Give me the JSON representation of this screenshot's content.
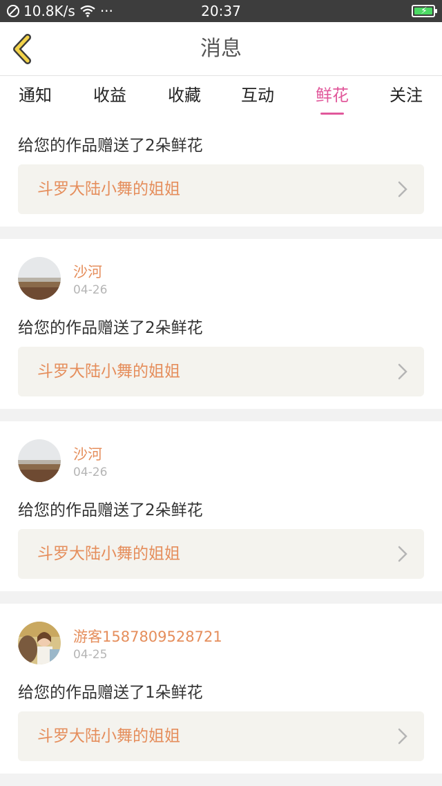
{
  "status_bar": {
    "speed": "10.8K/s",
    "dots": "···",
    "time": "20:37"
  },
  "header": {
    "title": "消息"
  },
  "tabs": [
    {
      "label": "通知",
      "active": false
    },
    {
      "label": "收益",
      "active": false
    },
    {
      "label": "收藏",
      "active": false
    },
    {
      "label": "互动",
      "active": false
    },
    {
      "label": "鲜花",
      "active": true
    },
    {
      "label": "关注",
      "active": false
    }
  ],
  "messages": [
    {
      "message": "给您的作品赠送了2朵鲜花",
      "work": "斗罗大陆小舞的姐姐"
    },
    {
      "user": "沙河",
      "date": "04-26",
      "message": "给您的作品赠送了2朵鲜花",
      "work": "斗罗大陆小舞的姐姐"
    },
    {
      "user": "沙河",
      "date": "04-26",
      "message": "给您的作品赠送了2朵鲜花",
      "work": "斗罗大陆小舞的姐姐"
    },
    {
      "user": "游客1587809528721",
      "date": "04-25",
      "message": "给您的作品赠送了1朵鲜花",
      "work": "斗罗大陆小舞的姐姐"
    }
  ],
  "colors": {
    "accent_pink": "#e1589b",
    "name_orange": "#e58e5c",
    "back_yellow": "#f3d34a"
  },
  "icons": {
    "back": "chevron-left-icon",
    "row_arrow": "chevron-right-icon",
    "wifi": "wifi-icon",
    "battery": "battery-charging-icon",
    "no_signal": "no-sim-icon"
  }
}
